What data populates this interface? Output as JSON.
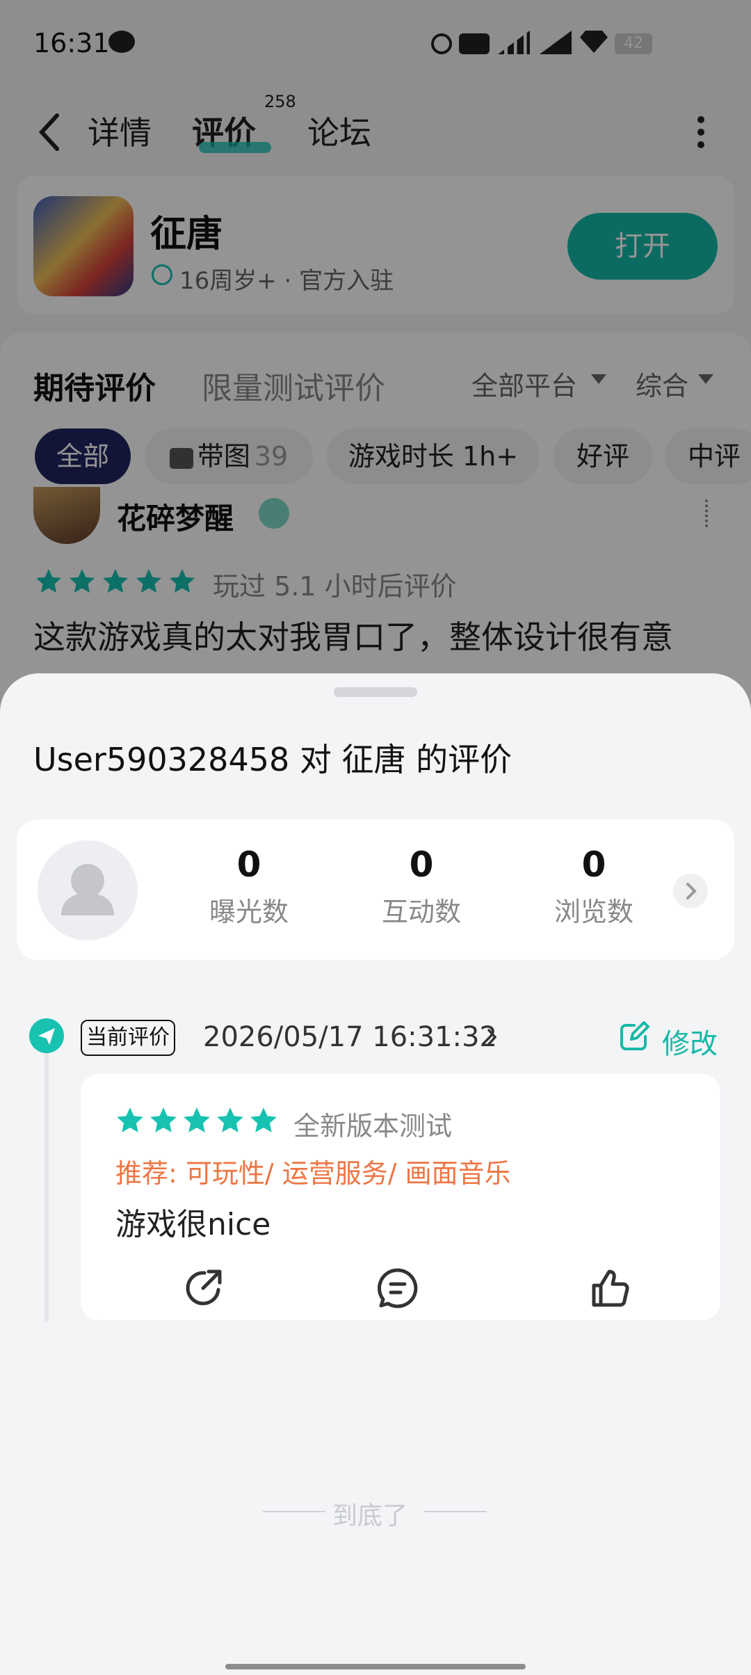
{
  "status_bar": {
    "time": "16:31",
    "battery": "42",
    "network": "4G"
  },
  "nav": {
    "tabs": [
      {
        "label": "详情"
      },
      {
        "label": "评价"
      },
      {
        "label": "论坛"
      }
    ],
    "review_count": "258"
  },
  "app": {
    "name": "征唐",
    "meta": "16周岁+ · 官方入驻",
    "open_label": "打开"
  },
  "review_tabs": {
    "primary": "期待评价",
    "secondary": "限量测试评价",
    "platform": "全部平台",
    "sort": "综合"
  },
  "filters": [
    {
      "label": "全部"
    },
    {
      "label": "带图",
      "count": "39"
    },
    {
      "label": "游戏时长 1h+"
    },
    {
      "label": "好评"
    },
    {
      "label": "中评"
    }
  ],
  "bg_review": {
    "user": "花碎梦醒",
    "played": "玩过 5.1 小时后评价",
    "text": "这款游戏真的太对我胃口了，整体设计很有意"
  },
  "sheet": {
    "title": "User590328458 对 征唐 的评价",
    "stats": [
      {
        "value": "0",
        "label": "曝光数"
      },
      {
        "value": "0",
        "label": "互动数"
      },
      {
        "value": "0",
        "label": "浏览数"
      }
    ],
    "current": {
      "badge": "当前评价",
      "date": "2026/05/17 16:31:32",
      "edit_label": "修改",
      "rating": 5,
      "tag": "全新版本测试",
      "recommend": "推荐: 可玩性/ 运营服务/ 画面音乐",
      "content": "游戏很nice"
    },
    "end_text": "到底了"
  },
  "colors": {
    "accent": "#18C2B1",
    "orange": "#EE7543",
    "dark_pill": "#1F2560"
  }
}
